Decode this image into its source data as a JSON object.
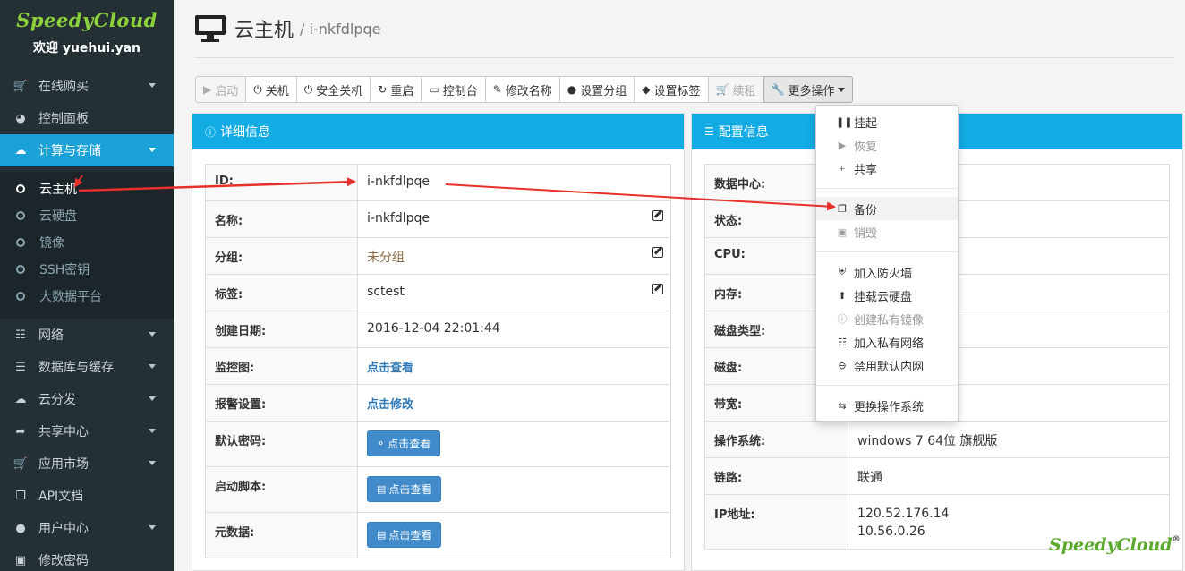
{
  "brand": {
    "logo": "SpeedyCloud",
    "welcome": "欢迎 yuehui.yan"
  },
  "sidebar": {
    "items": [
      {
        "label": "在线购买",
        "icon": "cart-icon"
      },
      {
        "label": "控制面板",
        "icon": "dashboard-icon"
      },
      {
        "label": "计算与存储",
        "icon": "cloud-icon"
      },
      {
        "label": "网络",
        "icon": "sitemap-icon"
      },
      {
        "label": "数据库与缓存",
        "icon": "database-icon"
      },
      {
        "label": "云分发",
        "icon": "cloud-upload-icon"
      },
      {
        "label": "共享中心",
        "icon": "share-icon"
      },
      {
        "label": "应用市场",
        "icon": "cart-icon"
      },
      {
        "label": "API文档",
        "icon": "copy-icon"
      },
      {
        "label": "用户中心",
        "icon": "user-icon"
      },
      {
        "label": "修改密码",
        "icon": "lock-icon"
      }
    ],
    "sub_items": [
      "云主机",
      "云硬盘",
      "镜像",
      "SSH密钥",
      "大数据平台"
    ]
  },
  "header": {
    "title": "云主机",
    "subtitle": "/ i-nkfdlpqe"
  },
  "toolbar": {
    "start": "启动",
    "shutdown": "关机",
    "safe_shutdown": "安全关机",
    "restart": "重启",
    "console": "控制台",
    "rename": "修改名称",
    "set_group": "设置分组",
    "set_tag": "设置标签",
    "renew": "续租",
    "more": "更多操作"
  },
  "detail": {
    "title": "详细信息",
    "rows": [
      {
        "key": "ID:",
        "value": "i-nkfdlpqe"
      },
      {
        "key": "名称:",
        "value": "i-nkfdlpqe"
      },
      {
        "key": "分组:",
        "value": "未分组"
      },
      {
        "key": "标签:",
        "value": "sctest"
      },
      {
        "key": "创建日期:",
        "value": "2016-12-04 22:01:44"
      },
      {
        "key": "监控图:",
        "value": "点击查看"
      },
      {
        "key": "报警设置:",
        "value": "点击修改"
      },
      {
        "key": "默认密码:",
        "value": "点击查看"
      },
      {
        "key": "启动脚本:",
        "value": "点击查看"
      },
      {
        "key": "元数据:",
        "value": "点击查看"
      }
    ]
  },
  "config": {
    "title": "配置信息",
    "rows": [
      {
        "key": "数据中心:",
        "value": ""
      },
      {
        "key": "状态:",
        "value": ""
      },
      {
        "key": "CPU:",
        "value": ""
      },
      {
        "key": "内存:",
        "value": ""
      },
      {
        "key": "磁盘类型:",
        "value": ""
      },
      {
        "key": "磁盘:",
        "value": ""
      },
      {
        "key": "带宽:",
        "value": ""
      },
      {
        "key": "操作系统:",
        "value": "windows 7 64位 旗舰版"
      },
      {
        "key": "链路:",
        "value": "联通"
      },
      {
        "key": "IP地址:",
        "value": "120.52.176.14",
        "value2": "10.56.0.26"
      }
    ]
  },
  "dropdown": {
    "items": [
      {
        "label": "挂起",
        "icon": "pause-icon"
      },
      {
        "label": "恢复",
        "icon": "play-icon"
      },
      {
        "label": "共享",
        "icon": "share-alt-icon"
      },
      {
        "label": "备份",
        "icon": "copy-icon"
      },
      {
        "label": "销毁",
        "icon": "trash-icon"
      },
      {
        "label": "加入防火墙",
        "icon": "shield-icon"
      },
      {
        "label": "挂载云硬盘",
        "icon": "upload-icon"
      },
      {
        "label": "创建私有镜像",
        "icon": "info-icon"
      },
      {
        "label": "加入私有网络",
        "icon": "sitemap-icon"
      },
      {
        "label": "禁用默认内网",
        "icon": "minus-circle-icon"
      },
      {
        "label": "更换操作系统",
        "icon": "exchange-icon"
      }
    ]
  },
  "watermark": "SpeedyCloud",
  "colors": {
    "accent": "#12abe3",
    "sidebar": "#253035",
    "active": "#1aa1d8",
    "link": "#337ab7",
    "arrow": "#e8302a"
  }
}
